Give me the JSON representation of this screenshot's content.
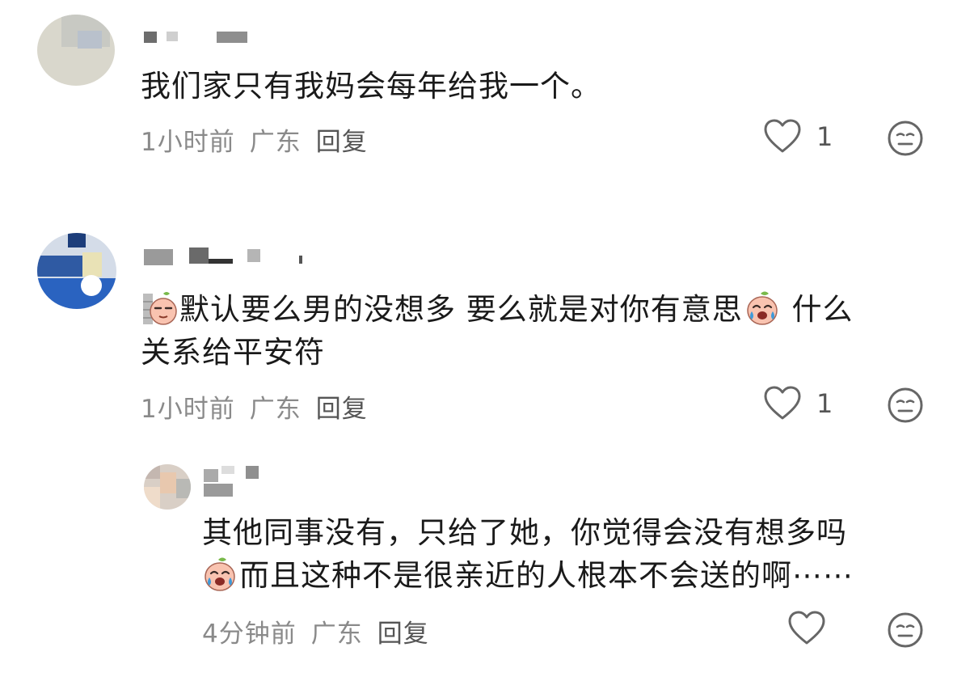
{
  "comments": [
    {
      "text": "我们家只有我妈会每年给我一个。",
      "time": "1小时前",
      "location": "广东",
      "reply_label": "回复",
      "like_count": "1",
      "icons": {
        "like": "heart-outline-icon",
        "dislike": "neutral-face-icon"
      }
    },
    {
      "text_line1_a": "默认要么男的没想多 要么就是对你有意思",
      "text_line1_b": " 什么",
      "text_line2": "关系给平安符",
      "time": "1小时前",
      "location": "广东",
      "reply_label": "回复",
      "like_count": "1",
      "emojis": [
        "peach-sneaky-emoji",
        "peach-crying-emoji"
      ],
      "icons": {
        "like": "heart-outline-icon",
        "dislike": "neutral-face-icon"
      }
    },
    {
      "text_line1": "其他同事没有，只给了她，你觉得会没有想多吗",
      "text_line2": "而且这种不是很亲近的人根本不会送的啊⋯⋯",
      "time": "4分钟前",
      "location": "广东",
      "reply_label": "回复",
      "like_count": "",
      "emojis": [
        "peach-crying-emoji"
      ],
      "icons": {
        "like": "heart-outline-icon",
        "dislike": "neutral-face-icon"
      }
    }
  ],
  "colors": {
    "text": "#1a1a1a",
    "meta": "#8a8a8a",
    "icon": "#666666"
  }
}
